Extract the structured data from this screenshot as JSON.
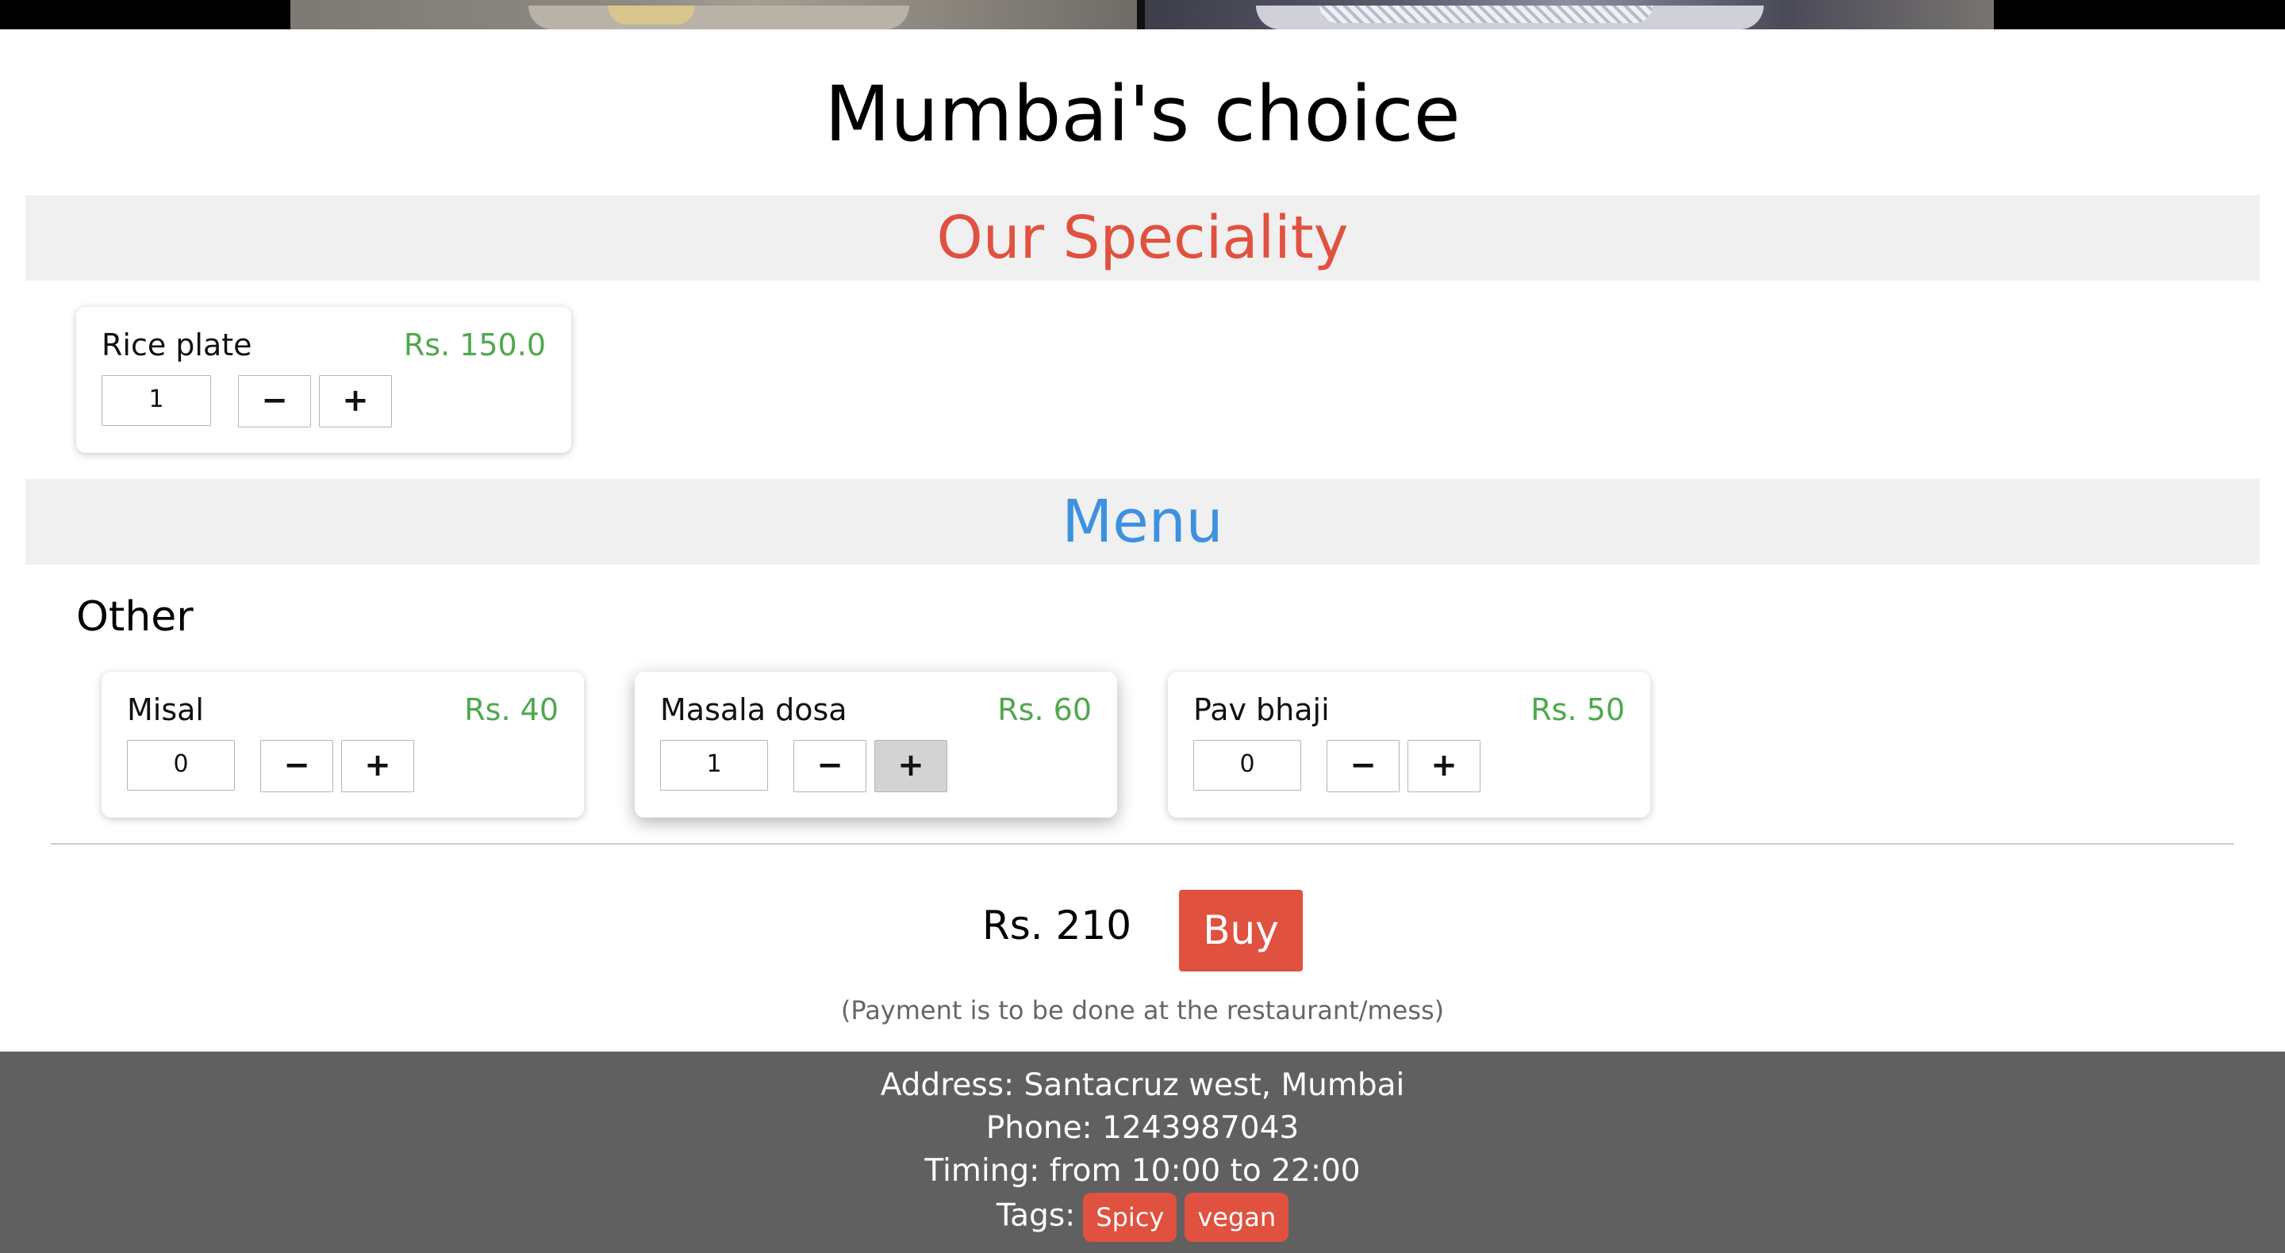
{
  "banner": {
    "left_image": "rice-plate-photo",
    "right_image": "rice-plate-photo"
  },
  "restaurant": {
    "name": "Mumbai's choice"
  },
  "speciality": {
    "heading": "Our Speciality",
    "items": [
      {
        "name": "Rice plate",
        "price": "Rs. 150.0",
        "quantity": "1",
        "minus_label": "−",
        "plus_label": "+"
      }
    ]
  },
  "menu": {
    "heading": "Menu",
    "categories": [
      {
        "name": "Other",
        "items": [
          {
            "name": "Misal",
            "price": "Rs. 40",
            "quantity": "0",
            "minus_label": "−",
            "plus_label": "+"
          },
          {
            "name": "Masala dosa",
            "price": "Rs. 60",
            "quantity": "1",
            "minus_label": "−",
            "plus_label": "+"
          },
          {
            "name": "Pav bhaji",
            "price": "Rs. 50",
            "quantity": "0",
            "minus_label": "−",
            "plus_label": "+"
          }
        ]
      }
    ]
  },
  "order": {
    "total": "Rs. 210",
    "buy_label": "Buy",
    "payment_note": "(Payment is to be done at the restaurant/mess)"
  },
  "footer": {
    "address": "Address: Santacruz west, Mumbai",
    "phone": "Phone: 1243987043",
    "timing": "Timing: from 10:00 to 22:00",
    "tags_label": "Tags:",
    "tags": [
      "Spicy",
      "vegan"
    ]
  },
  "colors": {
    "accent_red": "#e05140",
    "menu_blue": "#3d91e0",
    "price_green": "#4fa84b",
    "footer_bg": "#606060"
  }
}
